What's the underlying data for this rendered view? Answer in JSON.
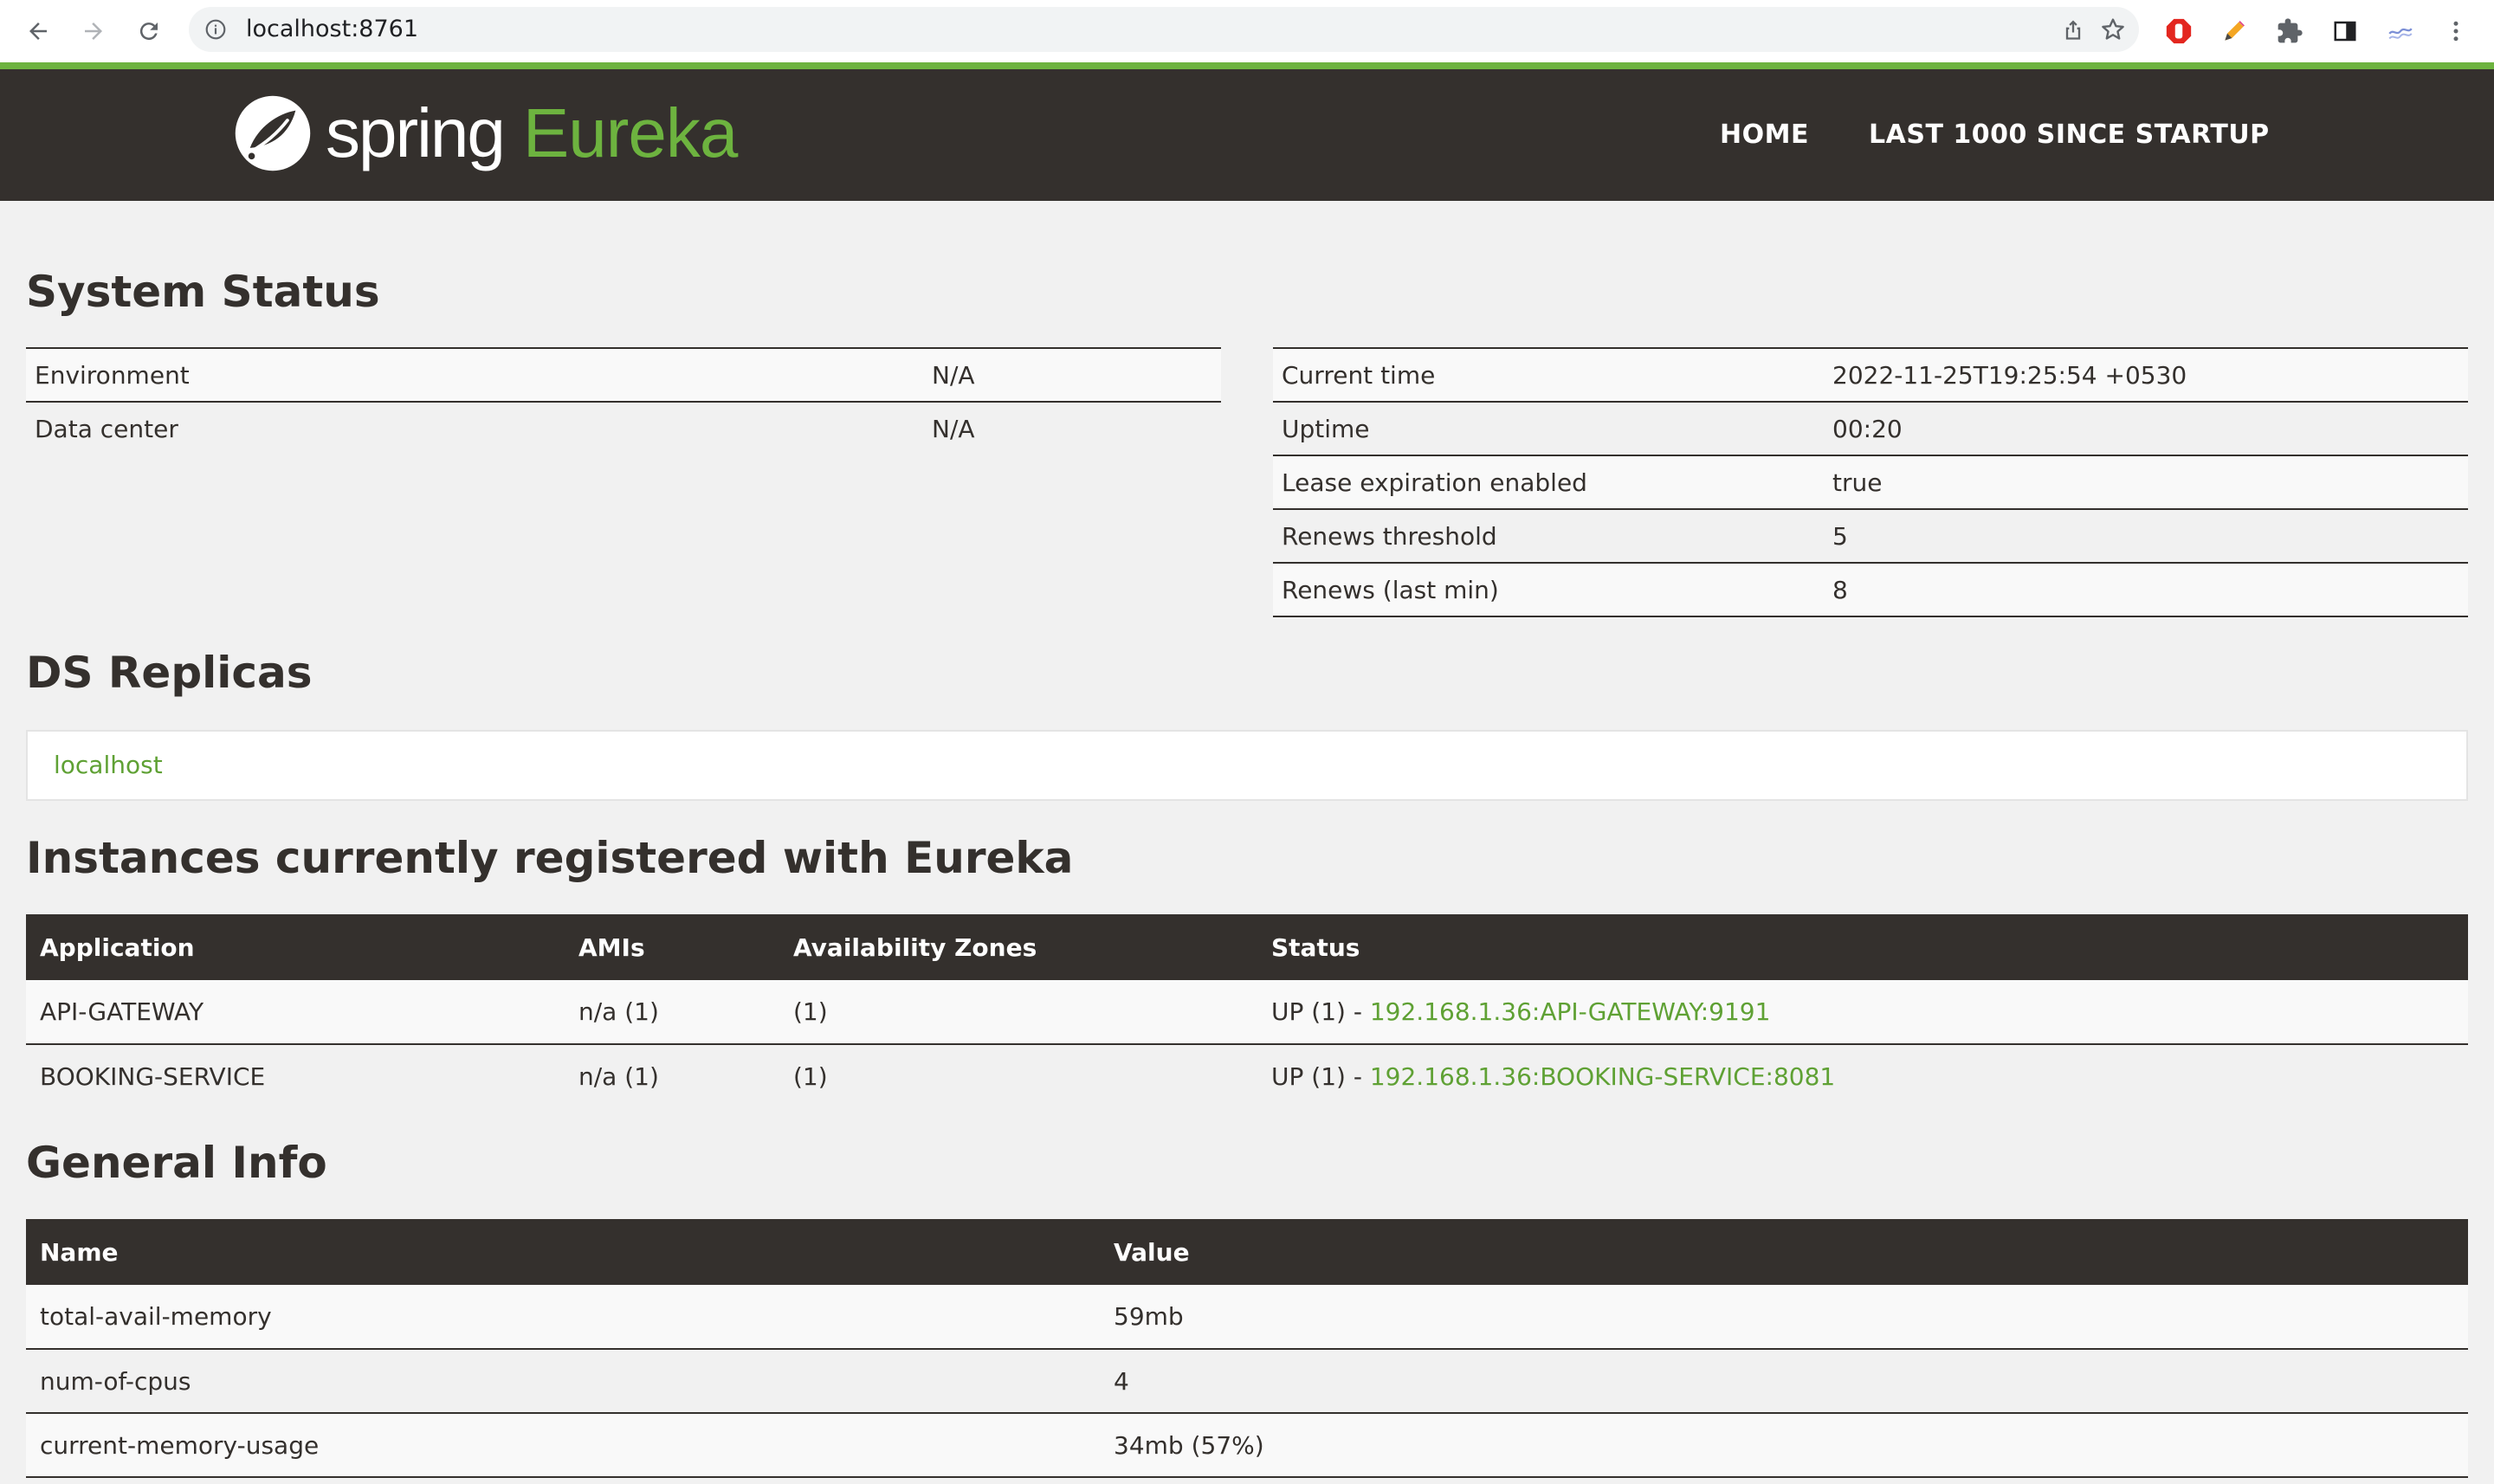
{
  "browser": {
    "url": "localhost:8761"
  },
  "navbar": {
    "logo_spring": "spring",
    "logo_eureka": "Eureka",
    "home": "HOME",
    "last_1000": "LAST 1000 SINCE STARTUP"
  },
  "system_status": {
    "title": "System Status",
    "left": [
      {
        "key": "Environment",
        "value": "N/A"
      },
      {
        "key": "Data center",
        "value": "N/A"
      }
    ],
    "right": [
      {
        "key": "Current time",
        "value": "2022-11-25T19:25:54 +0530"
      },
      {
        "key": "Uptime",
        "value": "00:20"
      },
      {
        "key": "Lease expiration enabled",
        "value": "true"
      },
      {
        "key": "Renews threshold",
        "value": "5"
      },
      {
        "key": "Renews (last min)",
        "value": "8"
      }
    ]
  },
  "ds_replicas": {
    "title": "DS Replicas",
    "items": [
      "localhost"
    ]
  },
  "instances": {
    "title": "Instances currently registered with Eureka",
    "headers": [
      "Application",
      "AMIs",
      "Availability Zones",
      "Status"
    ],
    "rows": [
      {
        "application": "API-GATEWAY",
        "amis": "n/a (1)",
        "zones": "(1)",
        "status_prefix": "UP (1) - ",
        "status_link": "192.168.1.36:API-GATEWAY:9191"
      },
      {
        "application": "BOOKING-SERVICE",
        "amis": "n/a (1)",
        "zones": "(1)",
        "status_prefix": "UP (1) - ",
        "status_link": "192.168.1.36:BOOKING-SERVICE:8081"
      }
    ]
  },
  "general_info": {
    "title": "General Info",
    "headers": [
      "Name",
      "Value"
    ],
    "rows": [
      {
        "name": "total-avail-memory",
        "value": "59mb"
      },
      {
        "name": "num-of-cpus",
        "value": "4"
      },
      {
        "name": "current-memory-usage",
        "value": "34mb (57%)"
      }
    ]
  },
  "colors": {
    "brand_green": "#6db33f",
    "link_green": "#5fa134",
    "dark": "#34302d"
  }
}
